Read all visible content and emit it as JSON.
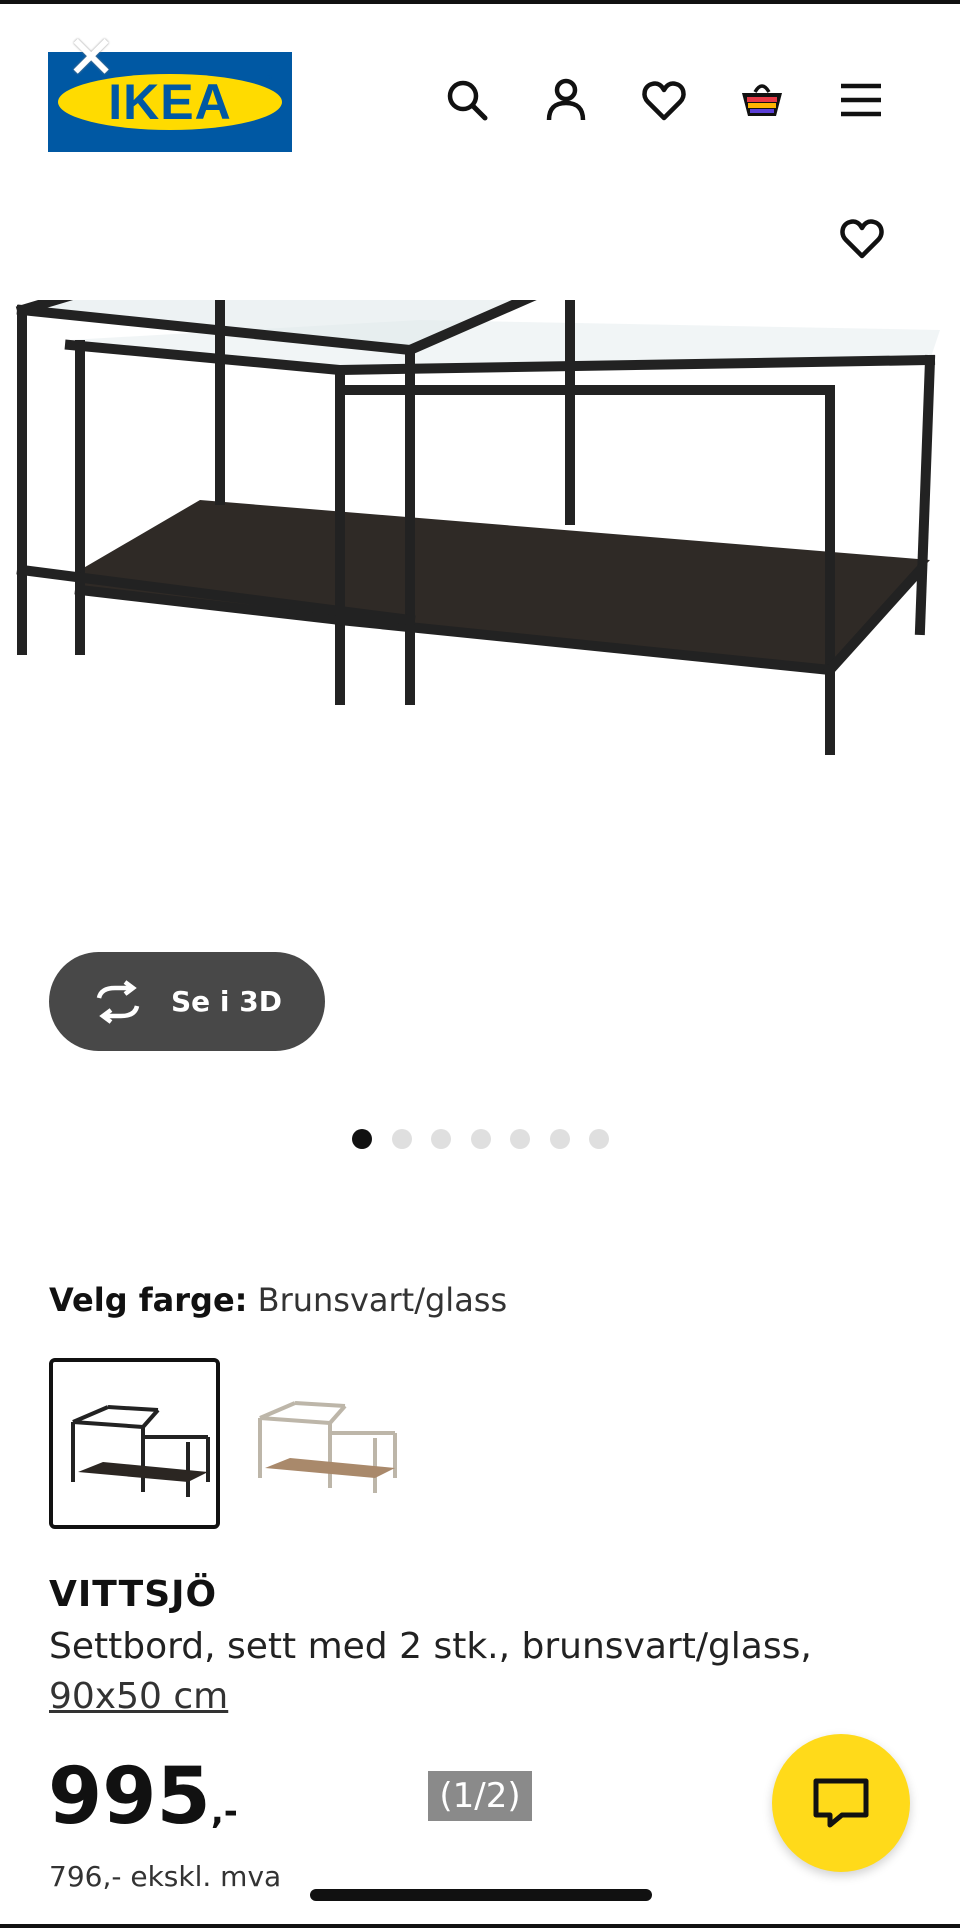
{
  "header": {
    "logo_text": "IKEA",
    "logo_reg": "®",
    "close_glyph": "✕",
    "icons": [
      "search-icon",
      "user-icon",
      "heart-icon",
      "basket-icon",
      "menu-icon"
    ]
  },
  "product": {
    "view_3d_label": "Se i 3D",
    "image_count": 7,
    "active_image_index": 0,
    "color_label": "Velg farge:",
    "color_value": "Brunsvart/glass",
    "name": "VITTSJÖ",
    "description": "Settbord, sett med 2 stk., brunsvart/glass,",
    "dimensions": "90x50 cm",
    "price_main": "995",
    "price_suffix": ",-",
    "price_ex_vat": "796,- ekskl. mva"
  },
  "overlay": {
    "pager_text": "(1/2)"
  },
  "colors": {
    "ikea_blue": "#0058a3",
    "ikea_yellow": "#ffdb00",
    "button_dark": "#484848",
    "chat_yellow": "#ffda1a"
  }
}
